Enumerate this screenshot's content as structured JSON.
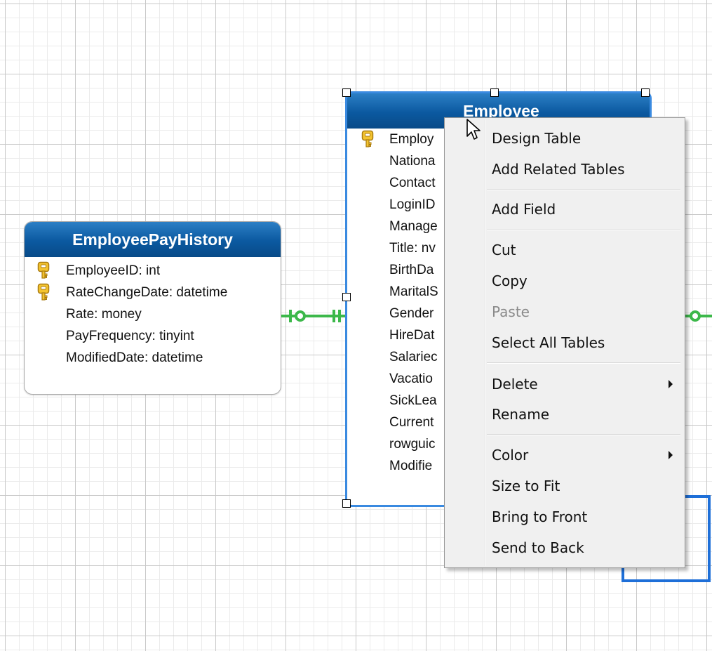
{
  "tables": {
    "employee_pay_history": {
      "name": "EmployeePayHistory",
      "fields": [
        {
          "text": "EmployeeID: int",
          "key": true
        },
        {
          "text": "RateChangeDate: datetime",
          "key": true
        },
        {
          "text": "Rate: money",
          "key": false
        },
        {
          "text": "PayFrequency: tinyint",
          "key": false
        },
        {
          "text": "ModifiedDate: datetime",
          "key": false
        }
      ]
    },
    "employee": {
      "name": "Employee",
      "fields": [
        {
          "text": "Employ",
          "key": true
        },
        {
          "text": "Nationa",
          "key": false
        },
        {
          "text": "Contact",
          "key": false
        },
        {
          "text": "LoginID",
          "key": false
        },
        {
          "text": "Manage",
          "key": false
        },
        {
          "text": "Title: nv",
          "key": false
        },
        {
          "text": "BirthDa",
          "key": false
        },
        {
          "text": "MaritalS",
          "key": false
        },
        {
          "text": "Gender",
          "key": false
        },
        {
          "text": "HireDat",
          "key": false
        },
        {
          "text": "Salariec",
          "key": false
        },
        {
          "text": "Vacatio",
          "key": false
        },
        {
          "text": "SickLea",
          "key": false
        },
        {
          "text": "Current",
          "key": false
        },
        {
          "text": "rowguic",
          "key": false
        },
        {
          "text": "Modifie",
          "key": false
        }
      ]
    }
  },
  "context_menu": {
    "design_table": "Design Table",
    "add_related_tables": "Add Related Tables",
    "add_field": "Add Field",
    "cut": "Cut",
    "copy": "Copy",
    "paste": "Paste",
    "select_all_tables": "Select All Tables",
    "delete": "Delete",
    "rename": "Rename",
    "color": "Color",
    "size_to_fit": "Size to Fit",
    "bring_to_front": "Bring to Front",
    "send_to_back": "Send to Back"
  },
  "colors": {
    "header_blue": "#0b59a0",
    "selection_blue": "#3a8ae0",
    "relationship_green": "#3cb84a",
    "key_gold": "#e8b21a"
  },
  "icons": {
    "primary_key": "key-icon",
    "cursor": "arrow-cursor-icon",
    "submenu": "chevron-right-icon"
  }
}
